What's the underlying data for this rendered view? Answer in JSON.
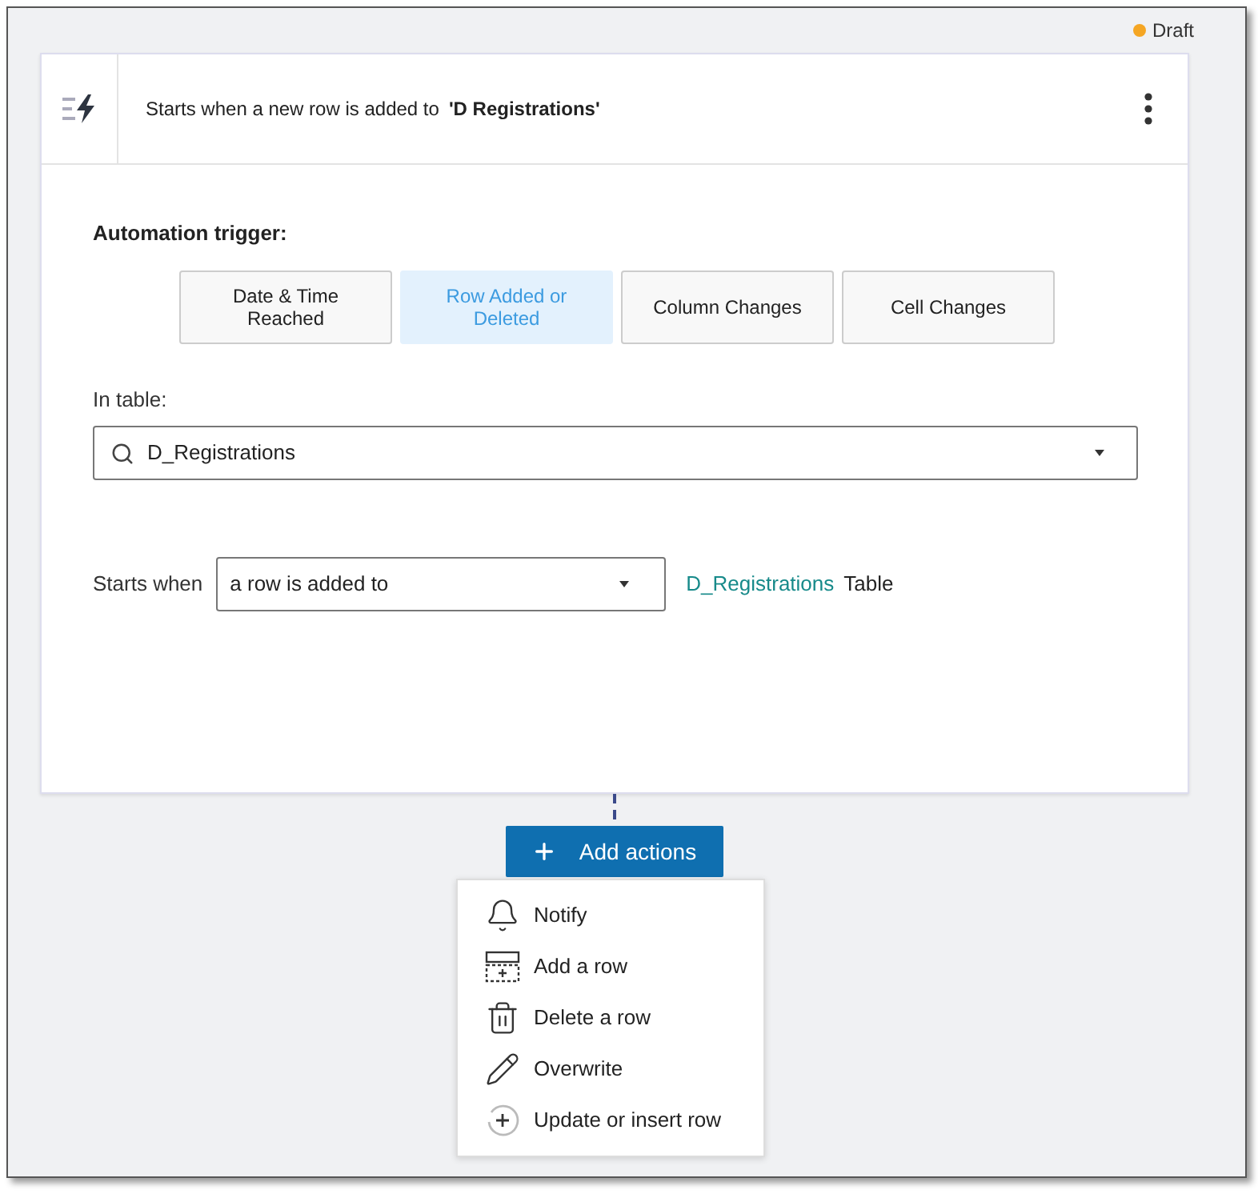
{
  "status": {
    "label": "Draft",
    "color": "#f5a623"
  },
  "header": {
    "text": "Starts when a new row is added to",
    "table": "'D Registrations'"
  },
  "trigger": {
    "label": "Automation trigger:",
    "options": [
      {
        "label": "Date & Time Reached",
        "selected": false
      },
      {
        "label": "Row Added or Deleted",
        "selected": true
      },
      {
        "label": "Column Changes",
        "selected": false
      },
      {
        "label": "Cell Changes",
        "selected": false
      }
    ]
  },
  "table_field": {
    "label": "In table:",
    "value": "D_Registrations"
  },
  "starts_when": {
    "label": "Starts when",
    "value": "a row is added to",
    "link": "D_Registrations",
    "suffix": "Table"
  },
  "add_actions": {
    "label": "Add actions"
  },
  "menu": [
    {
      "kind": "notify",
      "label": "Notify"
    },
    {
      "kind": "add",
      "label": "Add a row"
    },
    {
      "kind": "delete",
      "label": "Delete a row"
    },
    {
      "kind": "overwrite",
      "label": "Overwrite"
    },
    {
      "kind": "upsert",
      "label": "Update or insert row"
    }
  ]
}
